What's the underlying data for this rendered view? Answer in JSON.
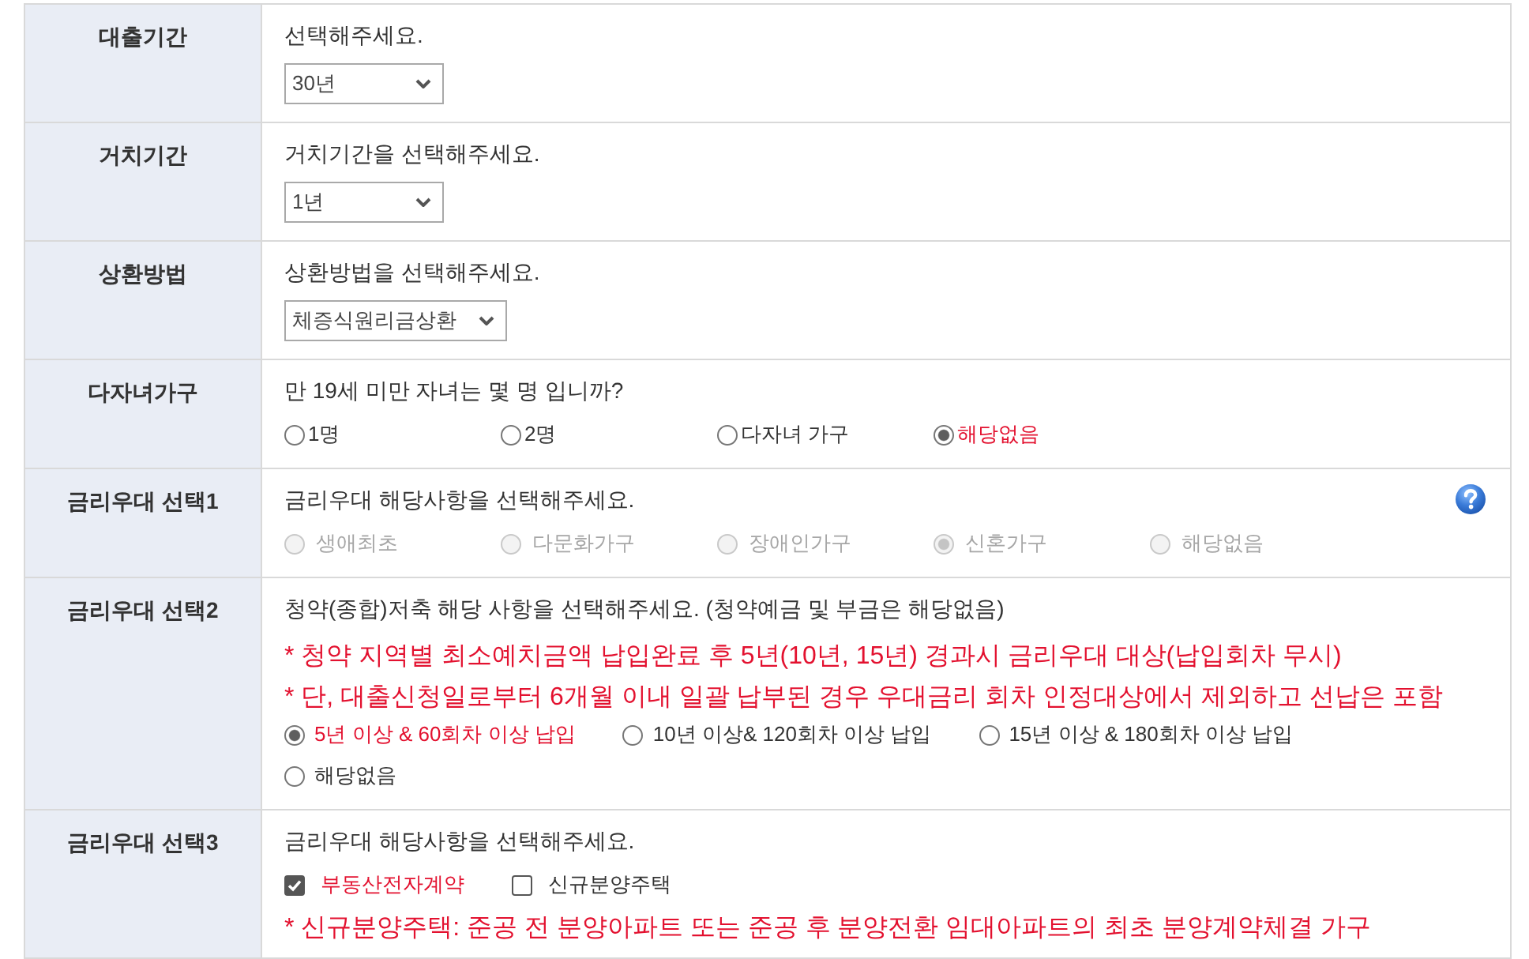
{
  "rows": [
    {
      "label": "대출기간",
      "content": [
        {
          "kind": "prompt",
          "text": "선택해주세요."
        },
        {
          "kind": "select",
          "value": "30년"
        }
      ]
    },
    {
      "label": "거치기간",
      "content": [
        {
          "kind": "prompt",
          "text": "거치기간을 선택해주세요."
        },
        {
          "kind": "select",
          "value": "1년"
        }
      ]
    },
    {
      "label": "상환방법",
      "content": [
        {
          "kind": "prompt",
          "text": "상환방법을 선택해주세요."
        },
        {
          "kind": "select",
          "value": "체증식원리금상환"
        }
      ]
    },
    {
      "label": "다자녀가구",
      "content": [
        {
          "kind": "prompt",
          "text": "만 19세 미만 자녀는 몇 명 입니까?"
        },
        {
          "kind": "radio_grid",
          "disabled": false,
          "options": [
            {
              "label": "1명",
              "selected": false
            },
            {
              "label": "2명",
              "selected": false
            },
            {
              "label": "다자녀 가구",
              "selected": false
            },
            {
              "label": "해당없음",
              "selected": true
            }
          ]
        }
      ]
    },
    {
      "label": "금리우대 선택1",
      "content": [
        {
          "kind": "prompt",
          "text": "금리우대 해당사항을 선택해주세요.",
          "help": true
        },
        {
          "kind": "radio_grid",
          "disabled": true,
          "options": [
            {
              "label": "생애최초",
              "selected": false
            },
            {
              "label": "다문화가구",
              "selected": false
            },
            {
              "label": "장애인가구",
              "selected": false
            },
            {
              "label": "신혼가구",
              "selected": true
            },
            {
              "label": "해당없음",
              "selected": false
            }
          ]
        }
      ]
    },
    {
      "label": "금리우대 선택2",
      "content": [
        {
          "kind": "prompt",
          "text": "청약(종합)저축 해당 사항을 선택해주세요. (청약예금 및 부금은 해당없음)"
        },
        {
          "kind": "note",
          "text": "* 청약 지역별 최소예치금액 납입완료 후 5년(10년, 15년) 경과시 금리우대 대상(납입회차 무시)"
        },
        {
          "kind": "note",
          "text": "* 단, 대출신청일로부터 6개월 이내 일괄 납부된 경우 우대금리 회차 인정대상에서 제외하고 선납은 포함"
        },
        {
          "kind": "radio_list",
          "disabled": false,
          "lines": [
            [
              {
                "label": "5년 이상 & 60회차 이상 납입",
                "selected": true
              },
              {
                "label": "10년 이상& 120회차 이상 납입",
                "selected": false
              },
              {
                "label": "15년 이상 & 180회차 이상 납입",
                "selected": false
              }
            ],
            [
              {
                "label": "해당없음",
                "selected": false
              }
            ]
          ]
        }
      ]
    },
    {
      "label": "금리우대 선택3",
      "content": [
        {
          "kind": "prompt",
          "text": "금리우대 해당사항을 선택해주세요."
        },
        {
          "kind": "checkbox_list",
          "options": [
            {
              "label": "부동산전자계약",
              "checked": true
            },
            {
              "label": "신규분양주택",
              "checked": false
            }
          ]
        },
        {
          "kind": "note",
          "text": "* 신규분양주택: 준공 전 분양아파트 또는 준공 후 분양전환 임대아파트의 최초 분양계약체결 가구"
        }
      ]
    }
  ]
}
